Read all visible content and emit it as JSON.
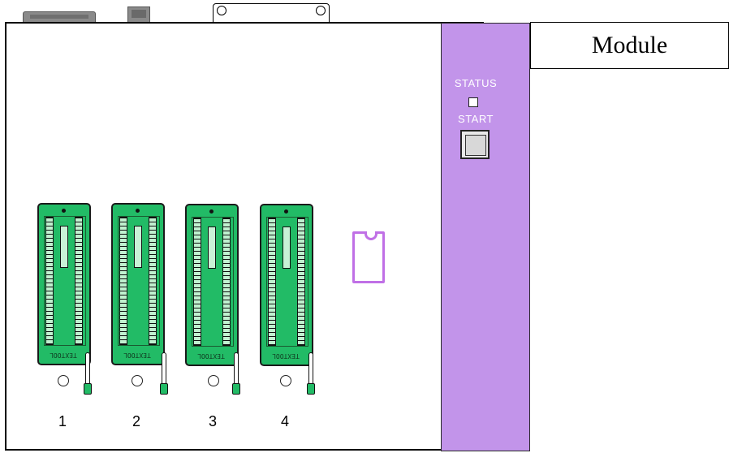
{
  "label": {
    "text": "Module"
  },
  "panel": {
    "status_label": "STATUS",
    "start_label": "START",
    "color": "#c294ea"
  },
  "sockets": [
    {
      "number": "1",
      "brand": "TEXTOOL"
    },
    {
      "number": "2",
      "brand": "TEXTOOL"
    },
    {
      "number": "3",
      "brand": "TEXTOOL"
    },
    {
      "number": "4",
      "brand": "TEXTOOL"
    }
  ],
  "colors": {
    "socket": "#22bb66",
    "chip_outline": "#c070e6"
  }
}
